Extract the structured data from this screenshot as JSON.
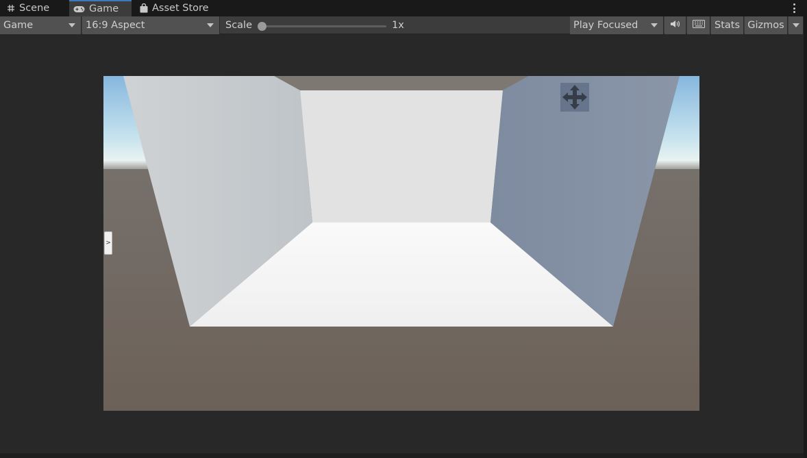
{
  "tabs": [
    {
      "label": "Scene",
      "icon": "hash-grid-icon"
    },
    {
      "label": "Game",
      "icon": "gamepad-icon",
      "active": true
    },
    {
      "label": "Asset Store",
      "icon": "shopping-bag-icon"
    }
  ],
  "toolbar": {
    "display": "Game",
    "aspect": "16:9 Aspect",
    "scale_label": "Scale",
    "scale_value": "1x",
    "scale_fraction": 0,
    "play_mode": "Play Focused",
    "audio_icon": "speaker-icon",
    "keyboard_icon": "keyboard-icon",
    "stats": "Stats",
    "gizmos": "Gizmos"
  },
  "viewport": {
    "drawer_toggle": ">",
    "move_tool_icon": "move-arrows-icon"
  },
  "colors": {
    "tab_active_underline": "#3a79bb",
    "toolbar_bg": "#3c3c3c",
    "sky": "#9fc9e6",
    "ground": "#6d6560",
    "floor": "#f3f3f3",
    "back_wall": "#e1e2e1",
    "left_wall": "#c6c9cc",
    "right_wall": "#8391a6",
    "ceiling": "#7e7872"
  }
}
